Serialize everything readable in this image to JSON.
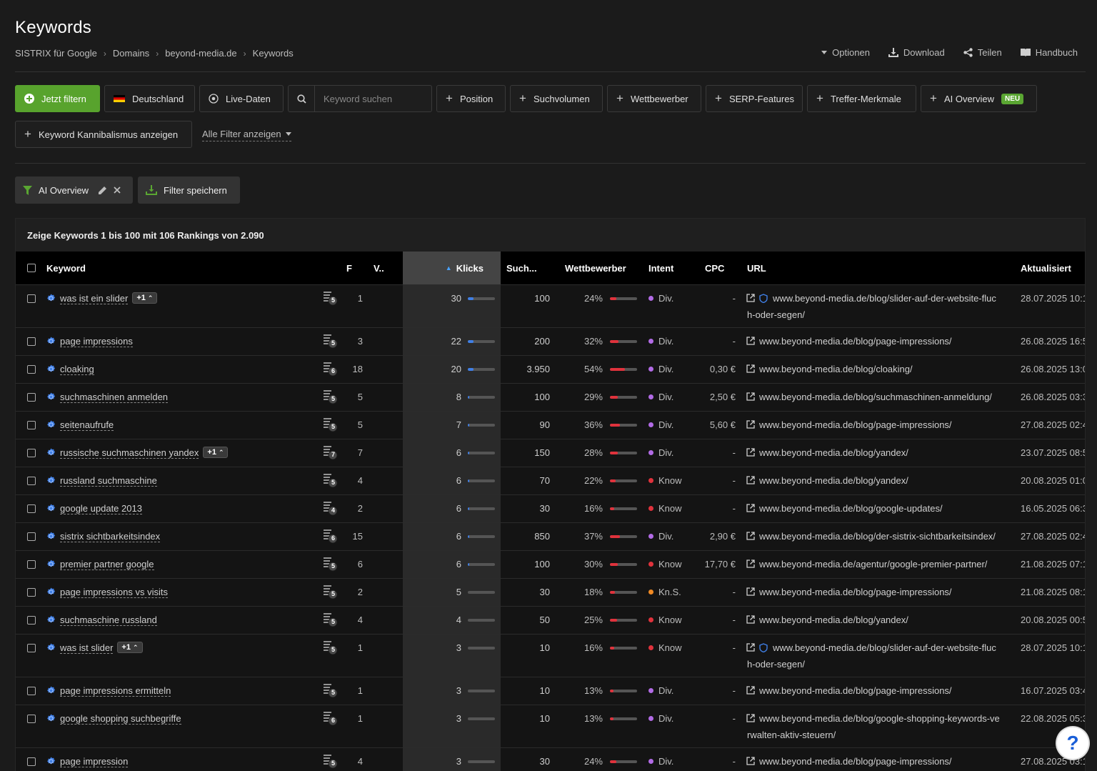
{
  "header": {
    "title": "Keywords",
    "breadcrumb": [
      "SISTRIX für Google",
      "Domains",
      "beyond-media.de",
      "Keywords"
    ],
    "actions": [
      "Optionen",
      "Download",
      "Teilen",
      "Handbuch"
    ]
  },
  "filters": {
    "apply": "Jetzt filtern",
    "country": "Deutschland",
    "live": "Live-Daten",
    "search_placeholder": "Keyword suchen",
    "position": "Position",
    "volume": "Suchvolumen",
    "competitor": "Wettbewerber",
    "serp": "SERP-Features",
    "hit": "Treffer-Merkmale",
    "ai": "AI Overview",
    "neu": "NEU",
    "cannibal": "Keyword Kannibalismus anzeigen",
    "all": "Alle Filter anzeigen"
  },
  "active_filter": {
    "label": "AI Overview",
    "save": "Filter speichern"
  },
  "table": {
    "summary": "Zeige Keywords 1 bis 100 mit 106 Rankings von 2.090",
    "headers": {
      "keyword": "Keyword",
      "f": "F",
      "v": "V..",
      "klicks": "Klicks",
      "such": "Such...",
      "wettbewerber": "Wettbewerber",
      "intent": "Intent",
      "cpc": "CPC",
      "url": "URL",
      "aktualisiert": "Aktualisiert"
    },
    "rows": [
      {
        "keyword": "was ist ein slider",
        "badge": "+1",
        "serp": "5",
        "pos": "1",
        "klicks": "30",
        "klicks_pct": 0.22,
        "vol": "100",
        "comp": "24%",
        "comp_pct": 0.24,
        "intent": "Div.",
        "intent_color": "#b26be6",
        "cpc": "-",
        "shield": true,
        "url": "www.beyond-media.de/blog/slider-auf-der-website-fluc",
        "url2": "h-oder-segen/",
        "date": "28.07.2025 10:1"
      },
      {
        "keyword": "page impressions",
        "badge": "",
        "serp": "5",
        "pos": "3",
        "klicks": "22",
        "klicks_pct": 0.2,
        "vol": "200",
        "comp": "32%",
        "comp_pct": 0.32,
        "intent": "Div.",
        "intent_color": "#b26be6",
        "cpc": "-",
        "shield": false,
        "url": "www.beyond-media.de/blog/page-impressions/",
        "url2": "",
        "date": "26.08.2025 16:5"
      },
      {
        "keyword": "cloaking",
        "badge": "",
        "serp": "6",
        "pos": "18",
        "klicks": "20",
        "klicks_pct": 0.2,
        "vol": "3.950",
        "comp": "54%",
        "comp_pct": 0.54,
        "intent": "Div.",
        "intent_color": "#b26be6",
        "cpc": "0,30 €",
        "shield": false,
        "url": "www.beyond-media.de/blog/cloaking/",
        "url2": "",
        "date": "26.08.2025 13:0"
      },
      {
        "keyword": "suchmaschinen anmelden",
        "badge": "",
        "serp": "5",
        "pos": "5",
        "klicks": "8",
        "klicks_pct": 0.06,
        "vol": "100",
        "comp": "29%",
        "comp_pct": 0.29,
        "intent": "Div.",
        "intent_color": "#b26be6",
        "cpc": "2,50 €",
        "shield": false,
        "url": "www.beyond-media.de/blog/suchmaschinen-anmeldung/",
        "url2": "",
        "date": "26.08.2025 03:3"
      },
      {
        "keyword": "seitenaufrufe",
        "badge": "",
        "serp": "5",
        "pos": "5",
        "klicks": "7",
        "klicks_pct": 0.05,
        "vol": "90",
        "comp": "36%",
        "comp_pct": 0.36,
        "intent": "Div.",
        "intent_color": "#b26be6",
        "cpc": "5,60 €",
        "shield": false,
        "url": "www.beyond-media.de/blog/page-impressions/",
        "url2": "",
        "date": "27.08.2025 02:4"
      },
      {
        "keyword": "russische suchmaschinen yandex",
        "badge": "+1",
        "serp": "7",
        "pos": "7",
        "klicks": "6",
        "klicks_pct": 0.04,
        "vol": "150",
        "comp": "28%",
        "comp_pct": 0.28,
        "intent": "Div.",
        "intent_color": "#b26be6",
        "cpc": "-",
        "shield": false,
        "url": "www.beyond-media.de/blog/yandex/",
        "url2": "",
        "date": "23.07.2025 08:5"
      },
      {
        "keyword": "russland suchmaschine",
        "badge": "",
        "serp": "5",
        "pos": "4",
        "klicks": "6",
        "klicks_pct": 0.04,
        "vol": "70",
        "comp": "22%",
        "comp_pct": 0.22,
        "intent": "Know",
        "intent_color": "#e0323c",
        "cpc": "-",
        "shield": false,
        "url": "www.beyond-media.de/blog/yandex/",
        "url2": "",
        "date": "20.08.2025 01:0"
      },
      {
        "keyword": "google update 2013",
        "badge": "",
        "serp": "4",
        "pos": "2",
        "klicks": "6",
        "klicks_pct": 0.04,
        "vol": "30",
        "comp": "16%",
        "comp_pct": 0.16,
        "intent": "Know",
        "intent_color": "#e0323c",
        "cpc": "-",
        "shield": false,
        "url": "www.beyond-media.de/blog/google-updates/",
        "url2": "",
        "date": "16.05.2025 06:3"
      },
      {
        "keyword": "sistrix sichtbarkeitsindex",
        "badge": "",
        "serp": "6",
        "pos": "15",
        "klicks": "6",
        "klicks_pct": 0.04,
        "vol": "850",
        "comp": "37%",
        "comp_pct": 0.37,
        "intent": "Div.",
        "intent_color": "#b26be6",
        "cpc": "2,90 €",
        "shield": false,
        "url": "www.beyond-media.de/blog/der-sistrix-sichtbarkeitsindex/",
        "url2": "",
        "date": "27.08.2025 02:4"
      },
      {
        "keyword": "premier partner google",
        "badge": "",
        "serp": "5",
        "pos": "6",
        "klicks": "6",
        "klicks_pct": 0.04,
        "vol": "100",
        "comp": "30%",
        "comp_pct": 0.3,
        "intent": "Know",
        "intent_color": "#e0323c",
        "cpc": "17,70 €",
        "shield": false,
        "url": "www.beyond-media.de/agentur/google-premier-partner/",
        "url2": "",
        "date": "21.08.2025 07:1"
      },
      {
        "keyword": "page impressions vs visits",
        "badge": "",
        "serp": "5",
        "pos": "2",
        "klicks": "5",
        "klicks_pct": 0.0,
        "vol": "30",
        "comp": "18%",
        "comp_pct": 0.18,
        "intent": "Kn.S.",
        "intent_color": "#f08a24",
        "cpc": "-",
        "shield": false,
        "url": "www.beyond-media.de/blog/page-impressions/",
        "url2": "",
        "date": "21.08.2025 08:1"
      },
      {
        "keyword": "suchmaschine russland",
        "badge": "",
        "serp": "5",
        "pos": "4",
        "klicks": "4",
        "klicks_pct": 0.0,
        "vol": "50",
        "comp": "25%",
        "comp_pct": 0.25,
        "intent": "Know",
        "intent_color": "#e0323c",
        "cpc": "-",
        "shield": false,
        "url": "www.beyond-media.de/blog/yandex/",
        "url2": "",
        "date": "20.08.2025 00:5"
      },
      {
        "keyword": "was ist slider",
        "badge": "+1",
        "serp": "5",
        "pos": "1",
        "klicks": "3",
        "klicks_pct": 0.0,
        "vol": "10",
        "comp": "16%",
        "comp_pct": 0.16,
        "intent": "Know",
        "intent_color": "#e0323c",
        "cpc": "-",
        "shield": true,
        "url": "www.beyond-media.de/blog/slider-auf-der-website-fluc",
        "url2": "h-oder-segen/",
        "date": "28.07.2025 10:1"
      },
      {
        "keyword": "page impressions ermitteln",
        "badge": "",
        "serp": "5",
        "pos": "1",
        "klicks": "3",
        "klicks_pct": 0.0,
        "vol": "10",
        "comp": "13%",
        "comp_pct": 0.13,
        "intent": "Div.",
        "intent_color": "#b26be6",
        "cpc": "-",
        "shield": false,
        "url": "www.beyond-media.de/blog/page-impressions/",
        "url2": "",
        "date": "16.07.2025 03:4"
      },
      {
        "keyword": "google shopping suchbegriffe",
        "badge": "",
        "serp": "6",
        "pos": "1",
        "klicks": "3",
        "klicks_pct": 0.0,
        "vol": "10",
        "comp": "13%",
        "comp_pct": 0.13,
        "intent": "Div.",
        "intent_color": "#b26be6",
        "cpc": "-",
        "shield": false,
        "url": "www.beyond-media.de/blog/google-shopping-keywords-ve",
        "url2": "rwalten-aktiv-steuern/",
        "date": "22.08.2025 05:3"
      },
      {
        "keyword": "page impression",
        "badge": "",
        "serp": "5",
        "pos": "4",
        "klicks": "3",
        "klicks_pct": 0.0,
        "vol": "30",
        "comp": "24%",
        "comp_pct": 0.24,
        "intent": "Div.",
        "intent_color": "#b26be6",
        "cpc": "-",
        "shield": false,
        "url": "www.beyond-media.de/blog/page-impressions/",
        "url2": "",
        "date": "27.08.2025 03:1"
      }
    ]
  },
  "help": "?"
}
